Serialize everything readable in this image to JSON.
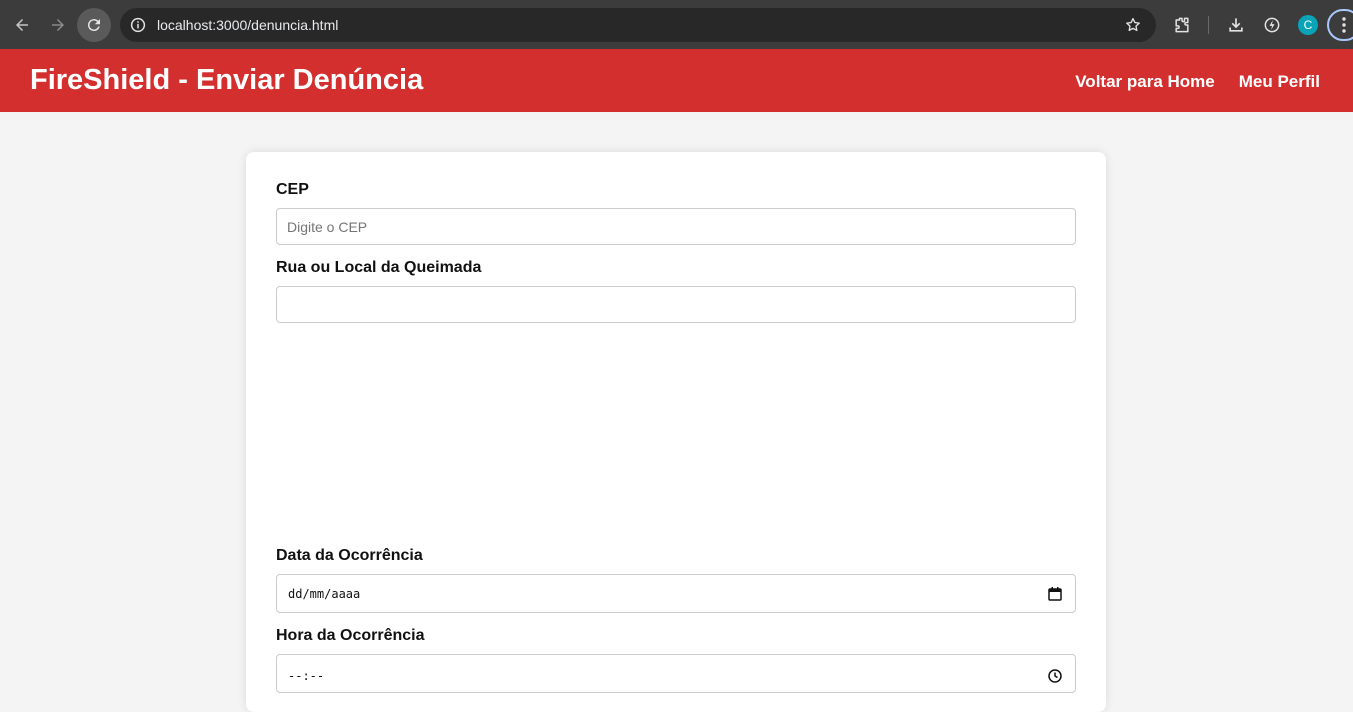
{
  "browser": {
    "url": "localhost:3000/denuncia.html",
    "profile_initial": "C"
  },
  "header": {
    "title": "FireShield - Enviar Denúncia",
    "nav": [
      {
        "label": "Voltar para Home"
      },
      {
        "label": "Meu Perfil"
      }
    ]
  },
  "form": {
    "cep": {
      "label": "CEP",
      "placeholder": "Digite o CEP",
      "value": ""
    },
    "street": {
      "label": "Rua ou Local da Queimada",
      "value": ""
    },
    "date": {
      "label": "Data da Ocorrência",
      "display": "dd/mm/aaaa"
    },
    "time": {
      "label": "Hora da Ocorrência",
      "display": "--:--"
    }
  },
  "colors": {
    "header_bg": "#d32f2f",
    "page_bg": "#f4f4f4",
    "card_bg": "#ffffff"
  }
}
